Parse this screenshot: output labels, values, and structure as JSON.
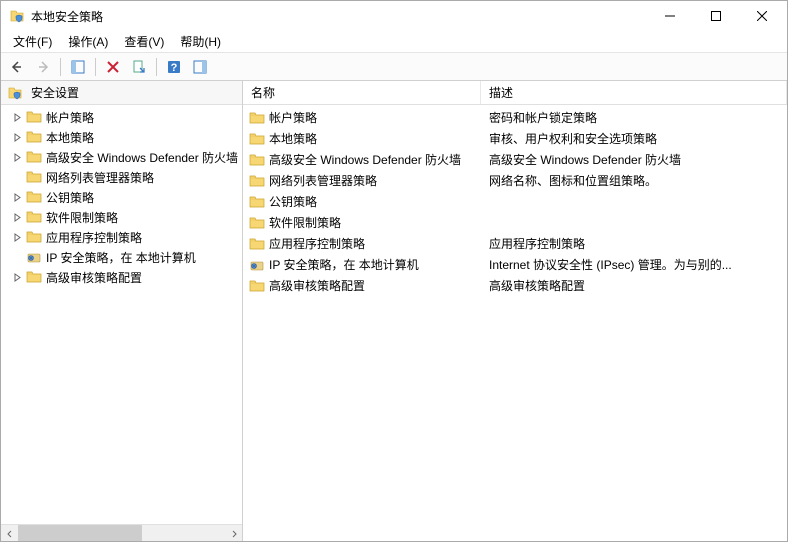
{
  "window": {
    "title": "本地安全策略"
  },
  "menu": {
    "file": "文件(F)",
    "action": "操作(A)",
    "view": "查看(V)",
    "help": "帮助(H)"
  },
  "tree": {
    "root": "安全设置",
    "items": [
      {
        "label": "帐户策略",
        "exp": true,
        "icon": "folder"
      },
      {
        "label": "本地策略",
        "exp": true,
        "icon": "folder"
      },
      {
        "label": "高级安全 Windows Defender 防火墙",
        "exp": true,
        "icon": "folder"
      },
      {
        "label": "网络列表管理器策略",
        "exp": false,
        "icon": "folder"
      },
      {
        "label": "公钥策略",
        "exp": true,
        "icon": "folder"
      },
      {
        "label": "软件限制策略",
        "exp": true,
        "icon": "folder"
      },
      {
        "label": "应用程序控制策略",
        "exp": true,
        "icon": "folder"
      },
      {
        "label": "IP 安全策略，在 本地计算机",
        "exp": false,
        "icon": "ipsec"
      },
      {
        "label": "高级审核策略配置",
        "exp": true,
        "icon": "folder"
      }
    ]
  },
  "list": {
    "col_name": "名称",
    "col_desc": "描述",
    "rows": [
      {
        "name": "帐户策略",
        "desc": "密码和帐户锁定策略",
        "icon": "folder"
      },
      {
        "name": "本地策略",
        "desc": "审核、用户权利和安全选项策略",
        "icon": "folder"
      },
      {
        "name": "高级安全 Windows Defender 防火墙",
        "desc": "高级安全 Windows Defender 防火墙",
        "icon": "folder"
      },
      {
        "name": "网络列表管理器策略",
        "desc": "网络名称、图标和位置组策略。",
        "icon": "folder"
      },
      {
        "name": "公钥策略",
        "desc": "",
        "icon": "folder"
      },
      {
        "name": "软件限制策略",
        "desc": "",
        "icon": "folder"
      },
      {
        "name": "应用程序控制策略",
        "desc": "应用程序控制策略",
        "icon": "folder"
      },
      {
        "name": "IP 安全策略，在 本地计算机",
        "desc": "Internet 协议安全性 (IPsec) 管理。为与别的...",
        "icon": "ipsec"
      },
      {
        "name": "高级审核策略配置",
        "desc": "高级审核策略配置",
        "icon": "folder"
      }
    ]
  }
}
